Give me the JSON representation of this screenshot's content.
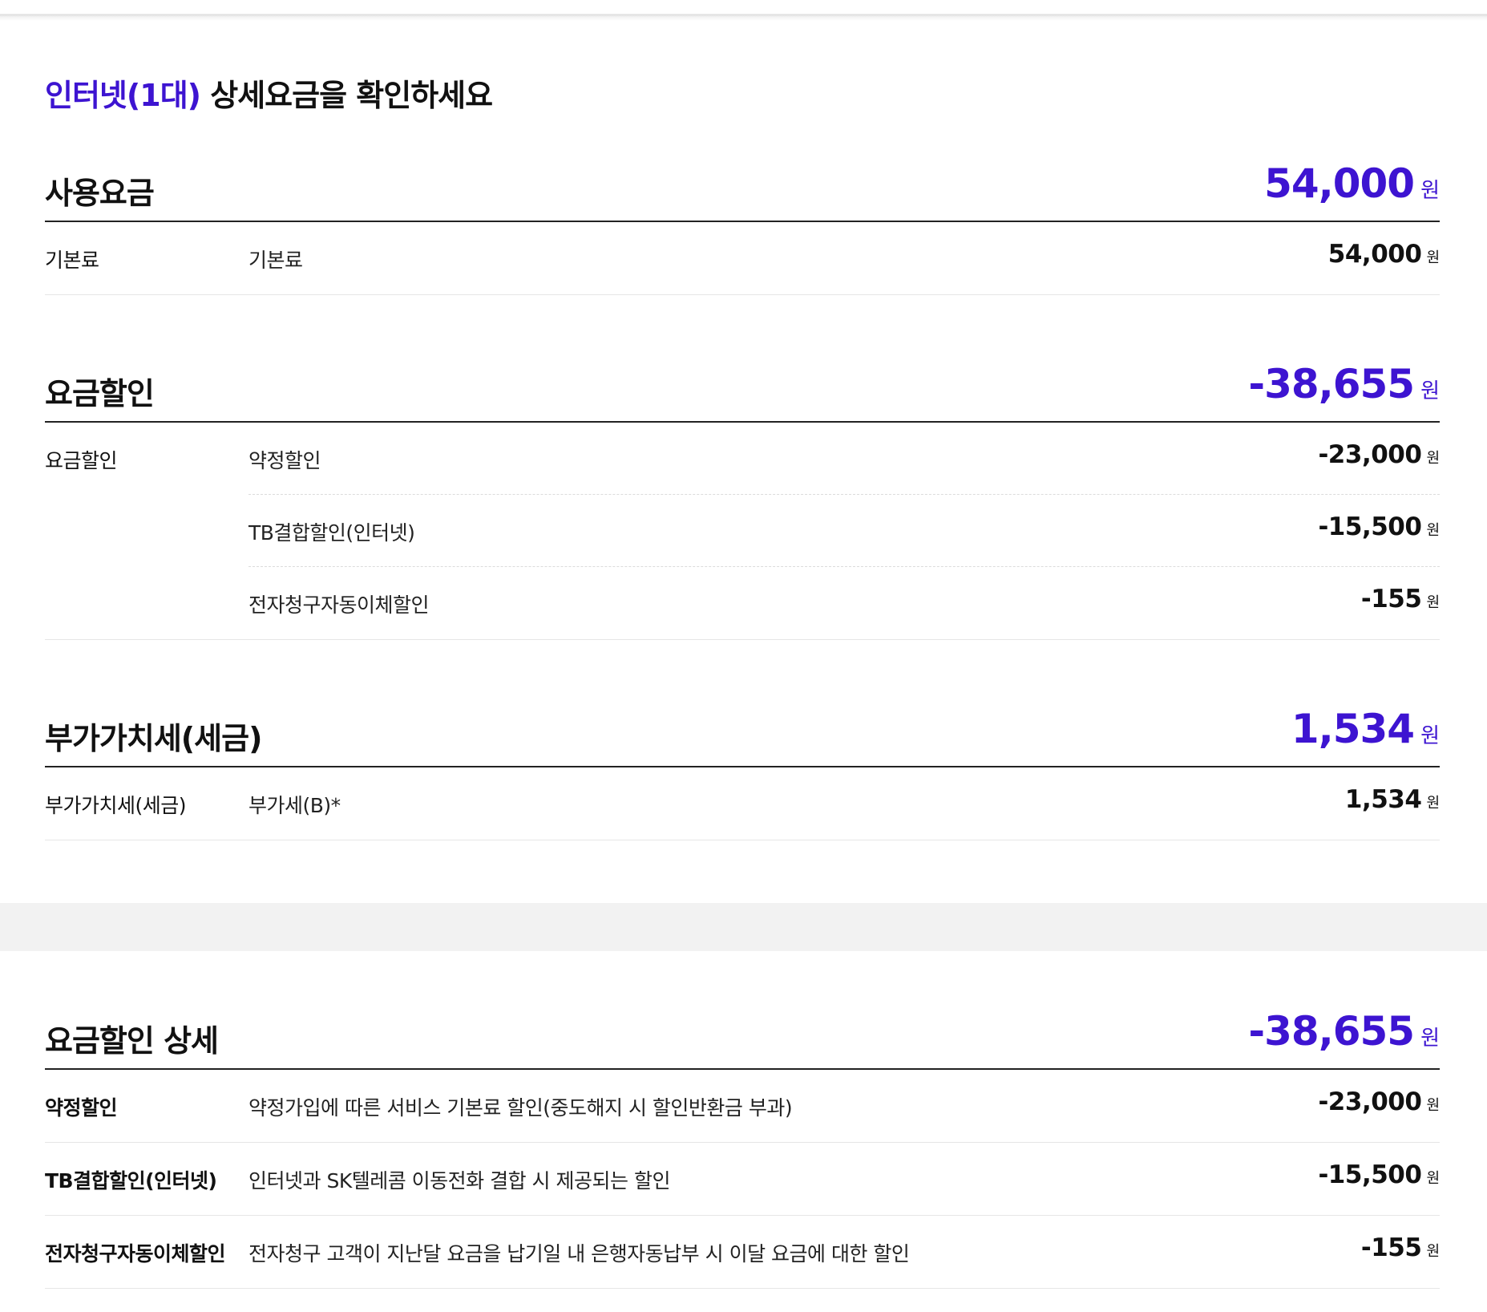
{
  "title": {
    "highlight": "인터넷(1대)",
    "rest": " 상세요금을 확인하세요"
  },
  "currency_unit": "원",
  "colors": {
    "accent": "#3d14d1",
    "text": "#111111",
    "divider_strong": "#222222",
    "divider_light": "#e6e6e6",
    "band": "#f2f2f2"
  },
  "usage": {
    "title": "사용요금",
    "total": "54,000",
    "rows": [
      {
        "label": "기본료",
        "detail": "기본료",
        "amount": "54,000"
      }
    ]
  },
  "discount": {
    "title": "요금할인",
    "total": "-38,655",
    "group_label": "요금할인",
    "rows": [
      {
        "detail": "약정할인",
        "amount": "-23,000"
      },
      {
        "detail": "TB결합할인(인터넷)",
        "amount": "-15,500"
      },
      {
        "detail": "전자청구자동이체할인",
        "amount": "-155"
      }
    ]
  },
  "vat": {
    "title": "부가가치세(세금)",
    "total": "1,534",
    "rows": [
      {
        "label": "부가가치세(세금)",
        "detail": "부가세(B)*",
        "amount": "1,534"
      }
    ]
  },
  "discount_detail": {
    "title": "요금할인 상세",
    "total": "-38,655",
    "rows": [
      {
        "label": "약정할인",
        "detail": "약정가입에 따른 서비스 기본료 할인(중도해지 시 할인반환금 부과)",
        "amount": "-23,000"
      },
      {
        "label": "TB결합할인(인터넷)",
        "detail": "인터넷과 SK텔레콤 이동전화 결합 시 제공되는 할인",
        "amount": "-15,500"
      },
      {
        "label": "전자청구자동이체할인",
        "detail": "전자청구 고객이 지난달 요금을 납기일 내 은행자동납부 시 이달 요금에 대한 할인",
        "amount": "-155"
      }
    ]
  }
}
